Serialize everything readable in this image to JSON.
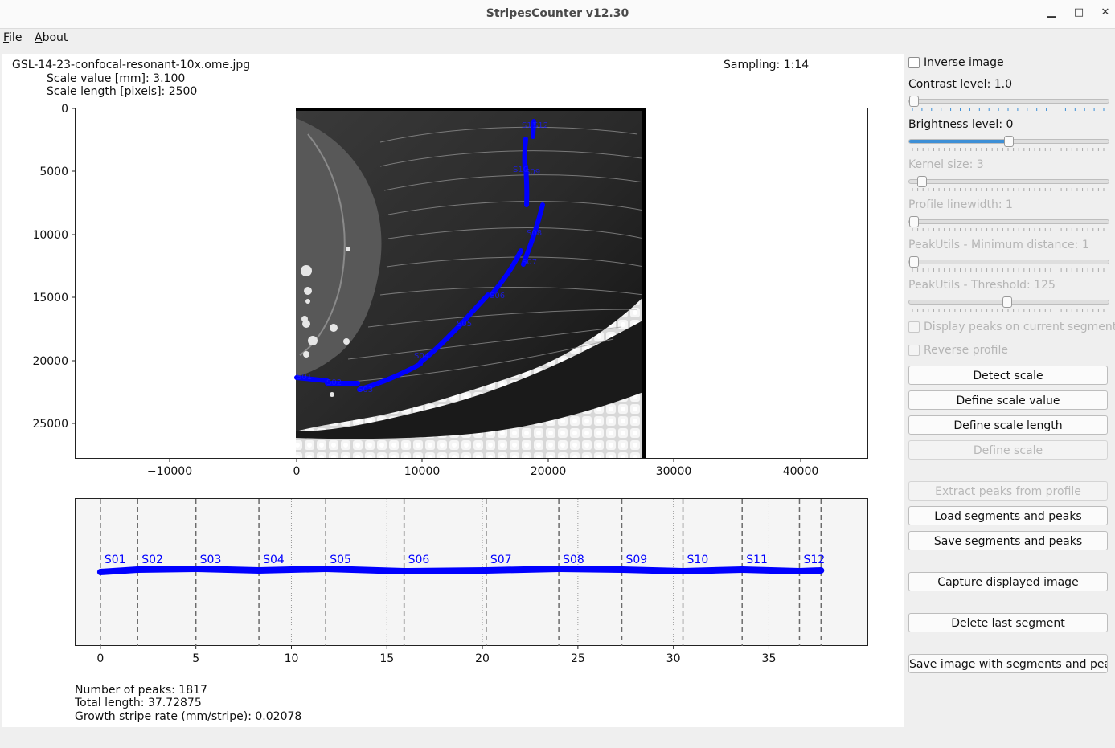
{
  "window": {
    "title": "StripesCounter v12.30",
    "minimize": "▁",
    "maximize": "□",
    "close": "✕"
  },
  "menu": [
    {
      "mnemonic": "F",
      "rest": "ile"
    },
    {
      "mnemonic": "A",
      "rest": "bout"
    }
  ],
  "info": {
    "filename": "GSL-14-23-confocal-resonant-10x.ome.jpg",
    "sampling": "Sampling: 1:14",
    "scale_value": "Scale value [mm]: 3.100",
    "scale_length": "Scale length [pixels]: 2500"
  },
  "image_plot": {
    "y_ticks": [
      "0",
      "5000",
      "10000",
      "15000",
      "20000",
      "25000"
    ],
    "x_ticks": [
      "−10000",
      "0",
      "10000",
      "20000",
      "30000",
      "40000"
    ],
    "segment_labels": [
      "S01",
      "S02",
      "S03",
      "S04",
      "S05",
      "S06",
      "S07",
      "S08",
      "S09",
      "S10",
      "S11",
      "S12"
    ],
    "path_color": "#0000ff"
  },
  "chart_data": {
    "type": "line",
    "x_ticks": [
      "0",
      "5",
      "10",
      "15",
      "20",
      "25",
      "30",
      "35"
    ],
    "xlim": [
      -1.3,
      40.2
    ],
    "segment_boundaries": [
      0,
      1.95,
      5.0,
      8.3,
      11.8,
      15.9,
      20.2,
      24.0,
      27.3,
      30.5,
      33.6,
      36.6,
      37.73
    ],
    "segment_labels": [
      "S01",
      "S02",
      "S03",
      "S04",
      "S05",
      "S06",
      "S07",
      "S08",
      "S09",
      "S10",
      "S11",
      "S12"
    ],
    "dotted_lines": [
      10.0,
      15.0,
      20.0,
      25.0,
      30.0,
      35.0
    ],
    "series_color": "#0000ff",
    "grid": false
  },
  "stats": {
    "peaks": "Number of peaks: 1817",
    "total_length": "Total length: 37.72875",
    "rate": "Growth stripe rate (mm/stripe): 0.02078"
  },
  "controls": {
    "inverse_image": "Inverse image",
    "contrast": "Contrast level: 1.0",
    "brightness": "Brightness level: 0",
    "kernel": "Kernel size: 3",
    "linewidth": "Profile linewidth: 1",
    "min_distance": "PeakUtils - Minimum distance: 1",
    "threshold": "PeakUtils - Threshold: 125",
    "display_peaks": "Display peaks on current segment",
    "reverse_profile": "Reverse profile",
    "brightness_fill": 0.5,
    "threshold_fill": 0.49
  },
  "buttons": {
    "detect_scale": "Detect scale",
    "define_scale_value": "Define scale value",
    "define_scale_length": "Define scale length",
    "define_scale": "Define scale",
    "extract_peaks": "Extract peaks from profile",
    "load_segments": "Load segments and peaks",
    "save_segments": "Save segments and peaks",
    "capture_image": "Capture displayed image",
    "delete_segment": "Delete last segment",
    "save_image": "Save image with segments and peaks"
  }
}
